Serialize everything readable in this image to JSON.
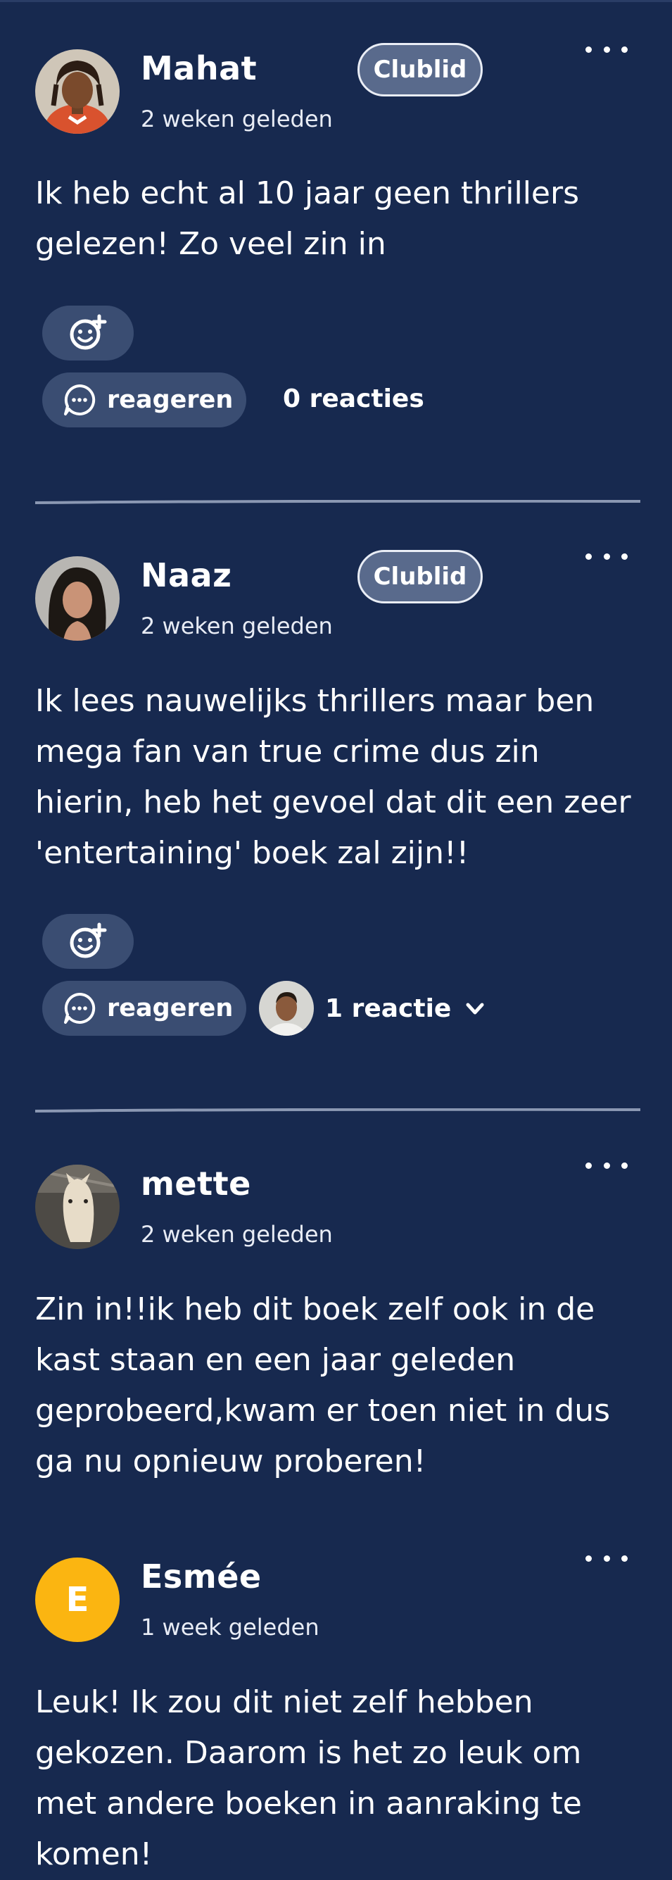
{
  "comments": [
    {
      "name": "Mahat",
      "time": "2 weken geleden",
      "badge": "Clublid",
      "text": "Ik heb echt al 10 jaar geen thrillers gelezen! Zo veel zin in",
      "reply_label": "reageren",
      "reactions_count": "0 reacties"
    },
    {
      "name": "Naaz",
      "time": "2 weken geleden",
      "badge": "Clublid",
      "text": "Ik lees nauwelijks thrillers maar ben mega fan van true crime dus zin hierin, heb het gevoel dat dit een zeer 'entertaining' boek zal zijn!!",
      "reply_label": "reageren",
      "reactions_count": "1 reactie"
    },
    {
      "name": "mette",
      "time": "2 weken geleden",
      "text": "Zin in!!ik heb dit boek zelf  ook in de kast staan en een jaar geleden geprobeerd,kwam er toen niet in dus ga nu opnieuw proberen!"
    },
    {
      "name": "Esmée",
      "time": "1 week geleden",
      "avatar_letter": "E",
      "avatar_color": "#fbb511",
      "text": "Leuk! Ik zou dit niet zelf hebben gekozen. Daarom is het zo leuk om met andere boeken in aanraking te komen!"
    }
  ],
  "colors": {
    "background": "#17294f",
    "pill": "#3a4d72",
    "badge": "#596a8c"
  }
}
